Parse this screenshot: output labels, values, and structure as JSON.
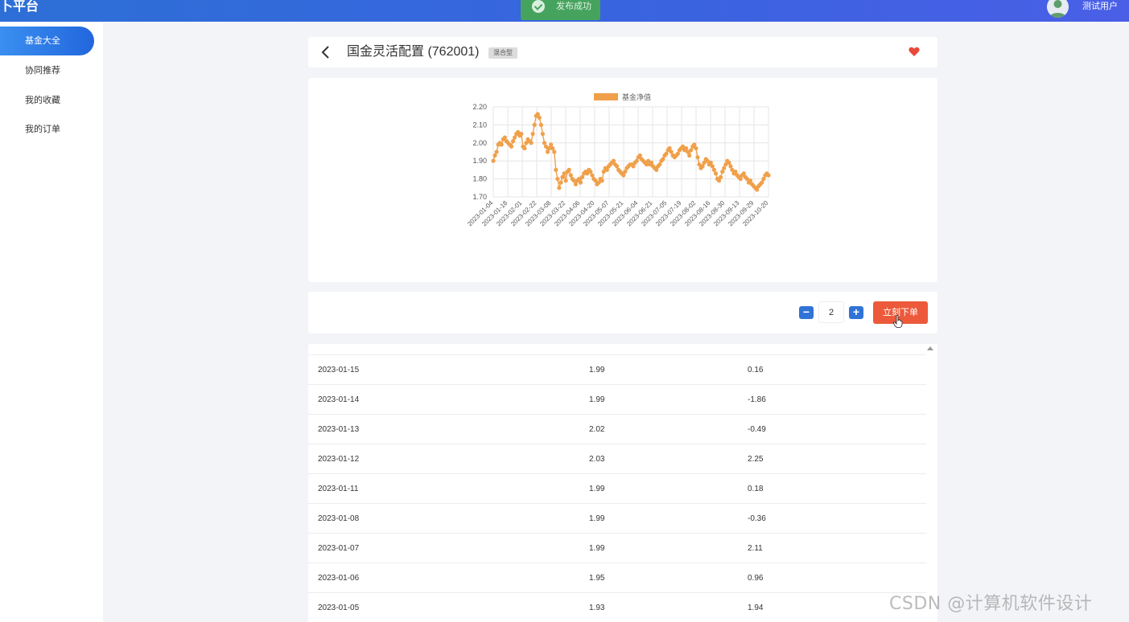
{
  "header": {
    "brand": "卜平台",
    "toast": "发布成功",
    "username": "测试用户"
  },
  "sidebar": {
    "items": [
      {
        "label": "基金大全",
        "active": true
      },
      {
        "label": "协同推荐",
        "active": false
      },
      {
        "label": "我的收藏",
        "active": false
      },
      {
        "label": "我的订单",
        "active": false
      }
    ]
  },
  "fund": {
    "name": "国金灵活配置 (762001)",
    "tag": "混合型",
    "favorite": true
  },
  "chart_data": {
    "type": "line",
    "legend": "基金净值",
    "color": "#f0a04b",
    "ylim": [
      1.7,
      2.2
    ],
    "yticks": [
      "2.20",
      "2.10",
      "2.00",
      "1.90",
      "1.80",
      "1.70"
    ],
    "xticks": [
      "2023-01-04",
      "2023-01-18",
      "2023-02-01",
      "2023-02-22",
      "2023-03-08",
      "2023-03-22",
      "2023-04-06",
      "2023-04-20",
      "2023-05-07",
      "2023-05-21",
      "2023-06-04",
      "2023-06-21",
      "2023-07-05",
      "2023-07-19",
      "2023-08-02",
      "2023-08-16",
      "2023-08-30",
      "2023-09-13",
      "2023-09-29",
      "2023-10-20"
    ],
    "values": [
      1.9,
      1.93,
      1.95,
      1.99,
      2.0,
      1.99,
      2.02,
      2.03,
      2.01,
      2.0,
      1.99,
      1.98,
      2.01,
      2.03,
      2.05,
      2.06,
      2.04,
      2.05,
      1.98,
      1.97,
      2.0,
      2.02,
      2.01,
      2.0,
      2.05,
      2.1,
      2.15,
      2.16,
      2.14,
      2.1,
      2.05,
      2.0,
      1.98,
      1.95,
      1.97,
      1.99,
      1.97,
      1.95,
      1.85,
      1.8,
      1.75,
      1.78,
      1.81,
      1.83,
      1.79,
      1.84,
      1.85,
      1.82,
      1.8,
      1.79,
      1.77,
      1.79,
      1.8,
      1.78,
      1.81,
      1.83,
      1.84,
      1.83,
      1.85,
      1.84,
      1.82,
      1.8,
      1.79,
      1.77,
      1.78,
      1.8,
      1.79,
      1.84,
      1.86,
      1.85,
      1.87,
      1.88,
      1.89,
      1.9,
      1.88,
      1.87,
      1.85,
      1.84,
      1.83,
      1.82,
      1.84,
      1.86,
      1.87,
      1.88,
      1.88,
      1.87,
      1.89,
      1.9,
      1.92,
      1.93,
      1.91,
      1.9,
      1.89,
      1.88,
      1.9,
      1.88,
      1.89,
      1.87,
      1.86,
      1.85,
      1.87,
      1.88,
      1.9,
      1.91,
      1.93,
      1.94,
      1.96,
      1.97,
      1.95,
      1.93,
      1.92,
      1.93,
      1.94,
      1.96,
      1.97,
      1.98,
      1.96,
      1.97,
      1.95,
      1.93,
      1.96,
      1.98,
      1.99,
      1.97,
      1.92,
      1.88,
      1.86,
      1.87,
      1.89,
      1.91,
      1.9,
      1.88,
      1.89,
      1.87,
      1.85,
      1.83,
      1.8,
      1.79,
      1.81,
      1.84,
      1.86,
      1.88,
      1.9,
      1.89,
      1.87,
      1.85,
      1.83,
      1.84,
      1.82,
      1.81,
      1.8,
      1.82,
      1.83,
      1.81,
      1.8,
      1.78,
      1.79,
      1.77,
      1.76,
      1.75,
      1.74,
      1.76,
      1.77,
      1.78,
      1.8,
      1.82,
      1.83,
      1.82
    ]
  },
  "order": {
    "minus_label": "−",
    "plus_label": "+",
    "quantity": "2",
    "submit_label": "立刻下单"
  },
  "history": {
    "rows": [
      {
        "date": "2023-01-15",
        "nav": "1.99",
        "change": "0.16"
      },
      {
        "date": "2023-01-14",
        "nav": "1.99",
        "change": "-1.86"
      },
      {
        "date": "2023-01-13",
        "nav": "2.02",
        "change": "-0.49"
      },
      {
        "date": "2023-01-12",
        "nav": "2.03",
        "change": "2.25"
      },
      {
        "date": "2023-01-11",
        "nav": "1.99",
        "change": "0.18"
      },
      {
        "date": "2023-01-08",
        "nav": "1.99",
        "change": "-0.36"
      },
      {
        "date": "2023-01-07",
        "nav": "1.99",
        "change": "2.11"
      },
      {
        "date": "2023-01-06",
        "nav": "1.95",
        "change": "0.96"
      },
      {
        "date": "2023-01-05",
        "nav": "1.93",
        "change": "1.94"
      }
    ]
  },
  "watermark": "CSDN @计算机软件设计"
}
